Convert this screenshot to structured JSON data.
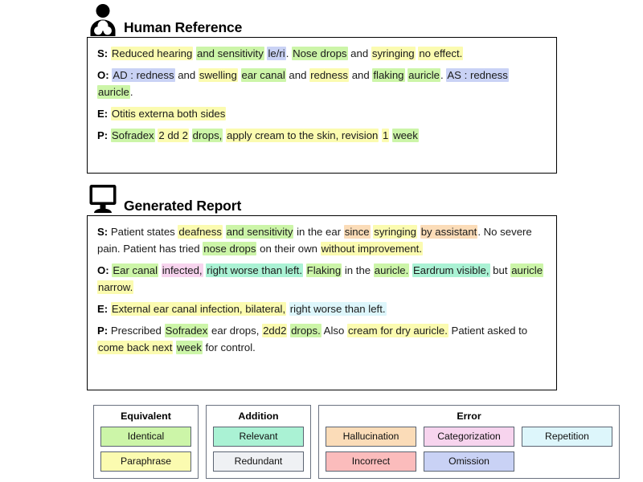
{
  "sections": {
    "human": {
      "icon": "person-user-icon",
      "title": "Human Reference",
      "lines": [
        {
          "label": "S:",
          "segments": [
            {
              "t": " ",
              "c": "none"
            },
            {
              "t": "Reduced hearing",
              "c": "paraphrase"
            },
            {
              "t": " ",
              "c": "none"
            },
            {
              "t": "and sensitivity",
              "c": "identical"
            },
            {
              "t": " ",
              "c": "none"
            },
            {
              "t": "le/ri",
              "c": "omission"
            },
            {
              "t": ". ",
              "c": "none"
            },
            {
              "t": "Nose drops",
              "c": "identical"
            },
            {
              "t": " and ",
              "c": "none"
            },
            {
              "t": "syringing",
              "c": "paraphrase"
            },
            {
              "t": " ",
              "c": "none"
            },
            {
              "t": "no effect.",
              "c": "paraphrase"
            }
          ]
        },
        {
          "label": "O:",
          "segments": [
            {
              "t": " ",
              "c": "none"
            },
            {
              "t": "AD : redness",
              "c": "omission"
            },
            {
              "t": " and ",
              "c": "none"
            },
            {
              "t": "swelling",
              "c": "paraphrase"
            },
            {
              "t": " ",
              "c": "none"
            },
            {
              "t": "ear canal",
              "c": "identical"
            },
            {
              "t": " and ",
              "c": "none"
            },
            {
              "t": "redness",
              "c": "paraphrase"
            },
            {
              "t": " and ",
              "c": "none"
            },
            {
              "t": "flaking",
              "c": "identical"
            },
            {
              "t": " ",
              "c": "none"
            },
            {
              "t": "auricle",
              "c": "identical"
            },
            {
              "t": ". ",
              "c": "none"
            },
            {
              "t": "AS : redness",
              "c": "omission"
            },
            {
              "t": " ",
              "c": "none"
            },
            {
              "t": "auricle",
              "c": "identical"
            },
            {
              "t": ".",
              "c": "none"
            }
          ]
        },
        {
          "label": "E:",
          "segments": [
            {
              "t": " ",
              "c": "none"
            },
            {
              "t": "Otitis externa both sides",
              "c": "paraphrase"
            }
          ]
        },
        {
          "label": "P:",
          "segments": [
            {
              "t": " ",
              "c": "none"
            },
            {
              "t": "Sofradex",
              "c": "identical"
            },
            {
              "t": " ",
              "c": "none"
            },
            {
              "t": "2 dd 2",
              "c": "paraphrase"
            },
            {
              "t": " ",
              "c": "none"
            },
            {
              "t": "drops,",
              "c": "identical"
            },
            {
              "t": " ",
              "c": "none"
            },
            {
              "t": "apply cream to the skin, revision",
              "c": "paraphrase"
            },
            {
              "t": "  ",
              "c": "none"
            },
            {
              "t": "1",
              "c": "paraphrase"
            },
            {
              "t": " ",
              "c": "none"
            },
            {
              "t": "week",
              "c": "identical"
            }
          ]
        }
      ]
    },
    "generated": {
      "icon": "desktop-monitor-icon",
      "title": "Generated Report",
      "lines": [
        {
          "label": "S:",
          "segments": [
            {
              "t": " Patient states ",
              "c": "none"
            },
            {
              "t": "deafness",
              "c": "paraphrase"
            },
            {
              "t": " ",
              "c": "none"
            },
            {
              "t": "and sensitivity",
              "c": "identical"
            },
            {
              "t": " in the ear ",
              "c": "none"
            },
            {
              "t": "since",
              "c": "hallucination"
            },
            {
              "t": " ",
              "c": "none"
            },
            {
              "t": "syringing",
              "c": "paraphrase"
            },
            {
              "t": " ",
              "c": "none"
            },
            {
              "t": "by assistant",
              "c": "hallucination"
            },
            {
              "t": ". No severe pain. Patient has tried ",
              "c": "none"
            },
            {
              "t": "nose drops",
              "c": "identical"
            },
            {
              "t": " on their own ",
              "c": "none"
            },
            {
              "t": "without improvement.",
              "c": "paraphrase"
            }
          ]
        },
        {
          "label": "O:",
          "segments": [
            {
              "t": " ",
              "c": "none"
            },
            {
              "t": "Ear canal",
              "c": "identical"
            },
            {
              "t": " ",
              "c": "none"
            },
            {
              "t": "infected,",
              "c": "categorization"
            },
            {
              "t": " ",
              "c": "none"
            },
            {
              "t": "right worse than left.",
              "c": "relevant"
            },
            {
              "t": " ",
              "c": "none"
            },
            {
              "t": "Flaking",
              "c": "identical"
            },
            {
              "t": " in the ",
              "c": "none"
            },
            {
              "t": "auricle.",
              "c": "identical"
            },
            {
              "t": " ",
              "c": "none"
            },
            {
              "t": "Eardrum visible,",
              "c": "relevant"
            },
            {
              "t": " but ",
              "c": "none"
            },
            {
              "t": "auricle",
              "c": "identical"
            },
            {
              "t": " ",
              "c": "none"
            },
            {
              "t": "narrow.",
              "c": "paraphrase"
            }
          ]
        },
        {
          "label": "E:",
          "segments": [
            {
              "t": " ",
              "c": "none"
            },
            {
              "t": "External ear canal infection, bilateral,",
              "c": "paraphrase"
            },
            {
              "t": " ",
              "c": "none"
            },
            {
              "t": "right worse than left.",
              "c": "repetition"
            }
          ]
        },
        {
          "label": "P:",
          "segments": [
            {
              "t": " Prescribed ",
              "c": "none"
            },
            {
              "t": "Sofradex",
              "c": "identical"
            },
            {
              "t": " ear drops, ",
              "c": "none"
            },
            {
              "t": "2dd2",
              "c": "paraphrase"
            },
            {
              "t": " ",
              "c": "none"
            },
            {
              "t": "drops.",
              "c": "identical"
            },
            {
              "t": " Also ",
              "c": "none"
            },
            {
              "t": "cream for dry auricle.",
              "c": "paraphrase"
            },
            {
              "t": " Patient asked to ",
              "c": "none"
            },
            {
              "t": "come back next",
              "c": "paraphrase"
            },
            {
              "t": " ",
              "c": "none"
            },
            {
              "t": "week",
              "c": "identical"
            },
            {
              "t": " for control.",
              "c": "none"
            }
          ]
        }
      ]
    }
  },
  "legend": {
    "groups": [
      {
        "title": "Equivalent",
        "rows": [
          [
            {
              "label": "Identical",
              "color": "#ccf5a8",
              "key": "identical"
            }
          ],
          [
            {
              "label": "Paraphrase",
              "color": "#fbfbb0",
              "key": "paraphrase"
            }
          ]
        ]
      },
      {
        "title": "Addition",
        "rows": [
          [
            {
              "label": "Relevant",
              "color": "#aaf2d4",
              "key": "relevant"
            }
          ],
          [
            {
              "label": "Redundant",
              "color": "#eff1f4",
              "key": "redundant"
            }
          ]
        ]
      },
      {
        "title": "Error",
        "rows": [
          [
            {
              "label": "Hallucination",
              "color": "#fbdcb8",
              "key": "hallucination"
            },
            {
              "label": "Categorization",
              "color": "#f7d4ee",
              "key": "categorization"
            },
            {
              "label": "Repetition",
              "color": "#ddf6fb",
              "key": "repetition"
            }
          ],
          [
            {
              "label": "Incorrect",
              "color": "#fbbcbc",
              "key": "incorrect"
            },
            {
              "label": "Omission",
              "color": "#c9d2f5",
              "key": "omission"
            }
          ]
        ]
      }
    ]
  }
}
